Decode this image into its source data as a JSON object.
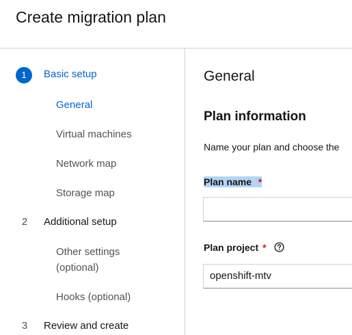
{
  "page": {
    "title": "Create migration plan"
  },
  "wizard": {
    "steps": [
      {
        "number": "1",
        "label": "Basic setup"
      },
      {
        "number": "2",
        "label": "Additional setup"
      },
      {
        "number": "3",
        "label": "Review and create"
      }
    ],
    "substeps": {
      "basic": [
        "General",
        "Virtual machines",
        "Network map",
        "Storage map"
      ],
      "additional": [
        "Other settings\n(optional)",
        "Hooks (optional)"
      ]
    }
  },
  "main": {
    "section_title": "General",
    "subsection_title": "Plan information",
    "description": "Name your plan and choose the",
    "plan_name": {
      "label": "Plan name",
      "required_marker": "*",
      "value": ""
    },
    "plan_project": {
      "label": "Plan project",
      "required_marker": "*",
      "value": "openshift-mtv",
      "help_icon": "question-circle-icon"
    }
  },
  "colors": {
    "accent": "#0066cc",
    "required": "#c9190b",
    "selection": "#b3d4f5"
  }
}
